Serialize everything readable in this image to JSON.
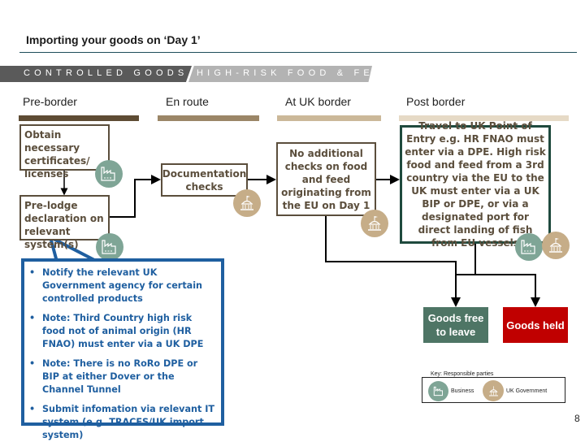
{
  "header": {
    "title": "Importing your goods on ‘Day 1’"
  },
  "categories": [
    {
      "label": "CONTROLLED GOODS",
      "color": "#5a5a5a"
    },
    {
      "label": "HIGH-RISK FOOD & FEED",
      "color": "#b3b3b3"
    }
  ],
  "stages": [
    {
      "label": "Pre-border",
      "color": "#5e4c34"
    },
    {
      "label": "En route",
      "color": "#9b8667"
    },
    {
      "label": "At UK border",
      "color": "#cbb899"
    },
    {
      "label": "Post border",
      "color": "#e6dac6"
    }
  ],
  "steps": {
    "obtain": {
      "text": "Obtain necessary certificates/ licenses",
      "party": "business"
    },
    "prelodge": {
      "text": "Pre-lodge declaration on relevant system(s)",
      "party": "business"
    },
    "documentation": {
      "text": "Documentation checks",
      "party": "uk-government"
    },
    "border": {
      "text": "No additional checks on food and feed originating from the EU on Day 1",
      "party": "uk-government"
    },
    "post": {
      "text": "Travel to UK Point of Entry e.g. HR FNAO must enter via a DPE. High risk food and feed from a 3rd country via the EU to the UK must enter via a UK BIP or DPE, or via a designated port for direct landing of fish from EU vessels",
      "parties": [
        "business",
        "uk-government"
      ]
    }
  },
  "callout": {
    "items": [
      "Notify the relevant UK Government agency for certain controlled products",
      "Note: Third Country high risk food not of animal origin (HR FNAO) must enter via a UK DPE",
      "Note: There is no RoRo DPE or BIP at either Dover or the Channel Tunnel",
      "Submit infomation via relevant IT system (e.g. TRACES/UK import system)"
    ],
    "color": "#1f5fa0"
  },
  "outcomes": {
    "free": {
      "label": "Goods free to leave",
      "color": "#4e7565"
    },
    "held": {
      "label": "Goods held",
      "color": "#c00000"
    }
  },
  "key": {
    "title": "Key: Responsible parties",
    "business": "Business",
    "government": "UK Government",
    "business_color": "#7fa596",
    "government_color": "#c6ad88"
  },
  "page_number": "8"
}
